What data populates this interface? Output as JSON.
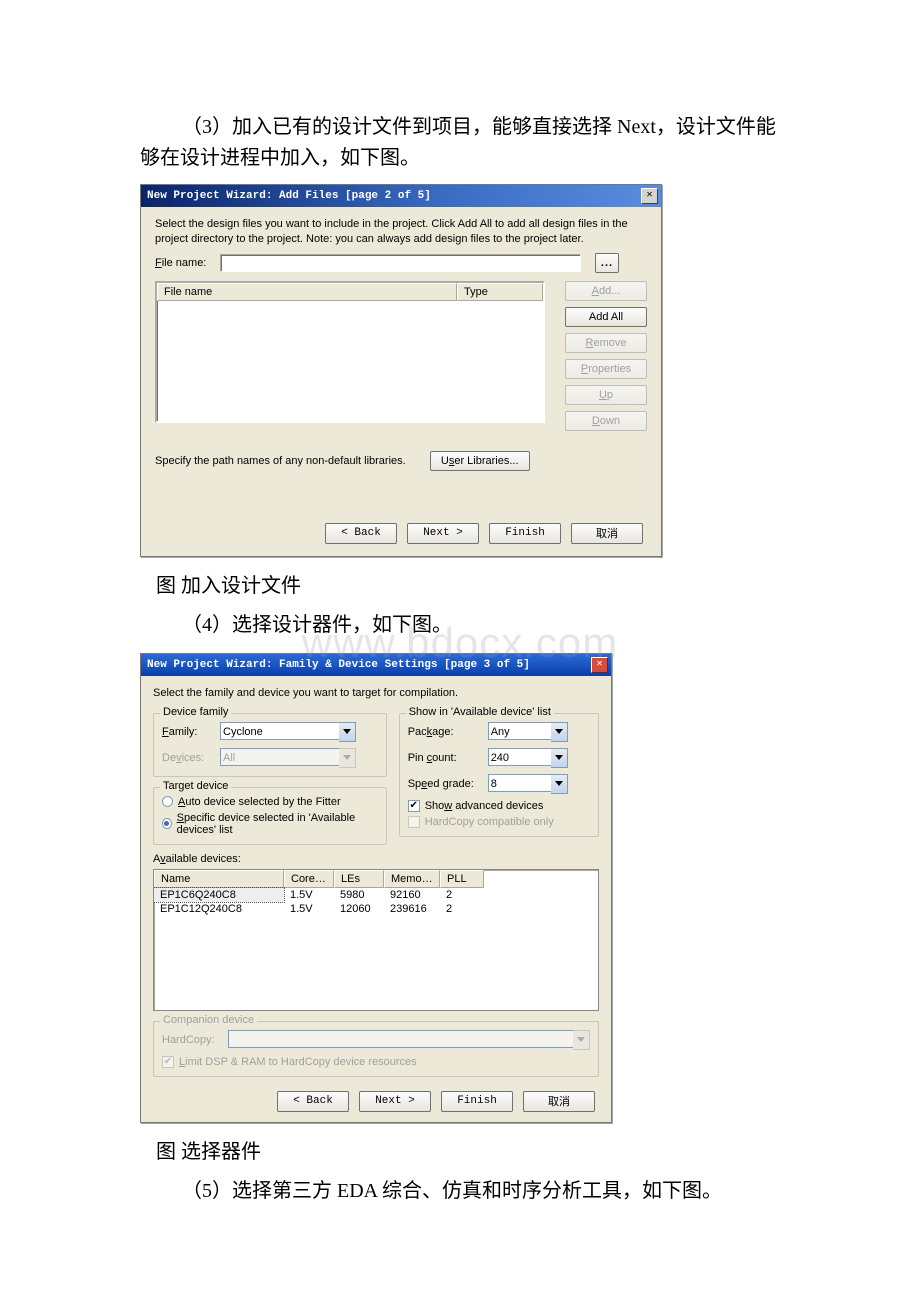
{
  "para3": "（3）加入已有的设计文件到项目，能够直接选择 Next，设计文件能够在设计进程中加入，如下图。",
  "caption1": "图 加入设计文件",
  "para4": "（4）选择设计器件，如下图。",
  "caption2": "图 选择器件",
  "para5": "（5）选择第三方 EDA 综合、仿真和时序分析工具，如下图。",
  "watermark": "www.bdocx.com",
  "dlg2": {
    "title": "New Project Wizard: Add Files [page 2 of 5]",
    "intro": "Select the design files you want to include in the project. Click Add All to add all design files in the project directory to the project. Note: you can always add design files to the project later.",
    "filename_label": "File name:",
    "filename_value": "",
    "dots": "...",
    "col_file": "File name",
    "col_type": "Type",
    "btn_add": "Add...",
    "btn_addall": "Add All",
    "btn_remove": "Remove",
    "btn_props": "Properties",
    "btn_up": "Up",
    "btn_down": "Down",
    "spec_label": "Specify the path names of any non-default libraries.",
    "btn_userlib": "User Libraries...",
    "footer": {
      "back": "< Back",
      "next": "Next >",
      "finish": "Finish",
      "cancel": "取消"
    }
  },
  "dlg3": {
    "title": "New Project Wizard: Family & Device Settings [page 3 of 5]",
    "intro": "Select the family and device you want to target for compilation.",
    "device_family": {
      "legend": "Device family",
      "family_label": "Family:",
      "family_value": "Cyclone",
      "devices_label": "Devices:",
      "devices_value": "All"
    },
    "target_device": {
      "legend": "Target device",
      "opt_auto": "Auto device selected by the Fitter",
      "opt_specific": "Specific device selected in 'Available devices' list"
    },
    "show_in": {
      "legend": "Show in 'Available device' list",
      "package_label": "Package:",
      "package_value": "Any",
      "pin_label": "Pin count:",
      "pin_value": "240",
      "speed_label": "Speed grade:",
      "speed_value": "8",
      "show_adv": "Show advanced devices",
      "hardcopy_only": "HardCopy compatible only"
    },
    "available_label": "Available devices:",
    "cols": [
      "Name",
      "Core v...",
      "LEs",
      "Memor...",
      "PLL"
    ],
    "rows": [
      {
        "name": "EP1C6Q240C8",
        "core": "1.5V",
        "les": "5980",
        "mem": "92160",
        "pll": "2"
      },
      {
        "name": "EP1C12Q240C8",
        "core": "1.5V",
        "les": "12060",
        "mem": "239616",
        "pll": "2"
      }
    ],
    "companion": {
      "legend": "Companion device",
      "hardcopy_label": "HardCopy:",
      "limit": "Limit DSP & RAM to HardCopy device resources"
    },
    "footer": {
      "back": "< Back",
      "next": "Next >",
      "finish": "Finish",
      "cancel": "取消"
    }
  }
}
